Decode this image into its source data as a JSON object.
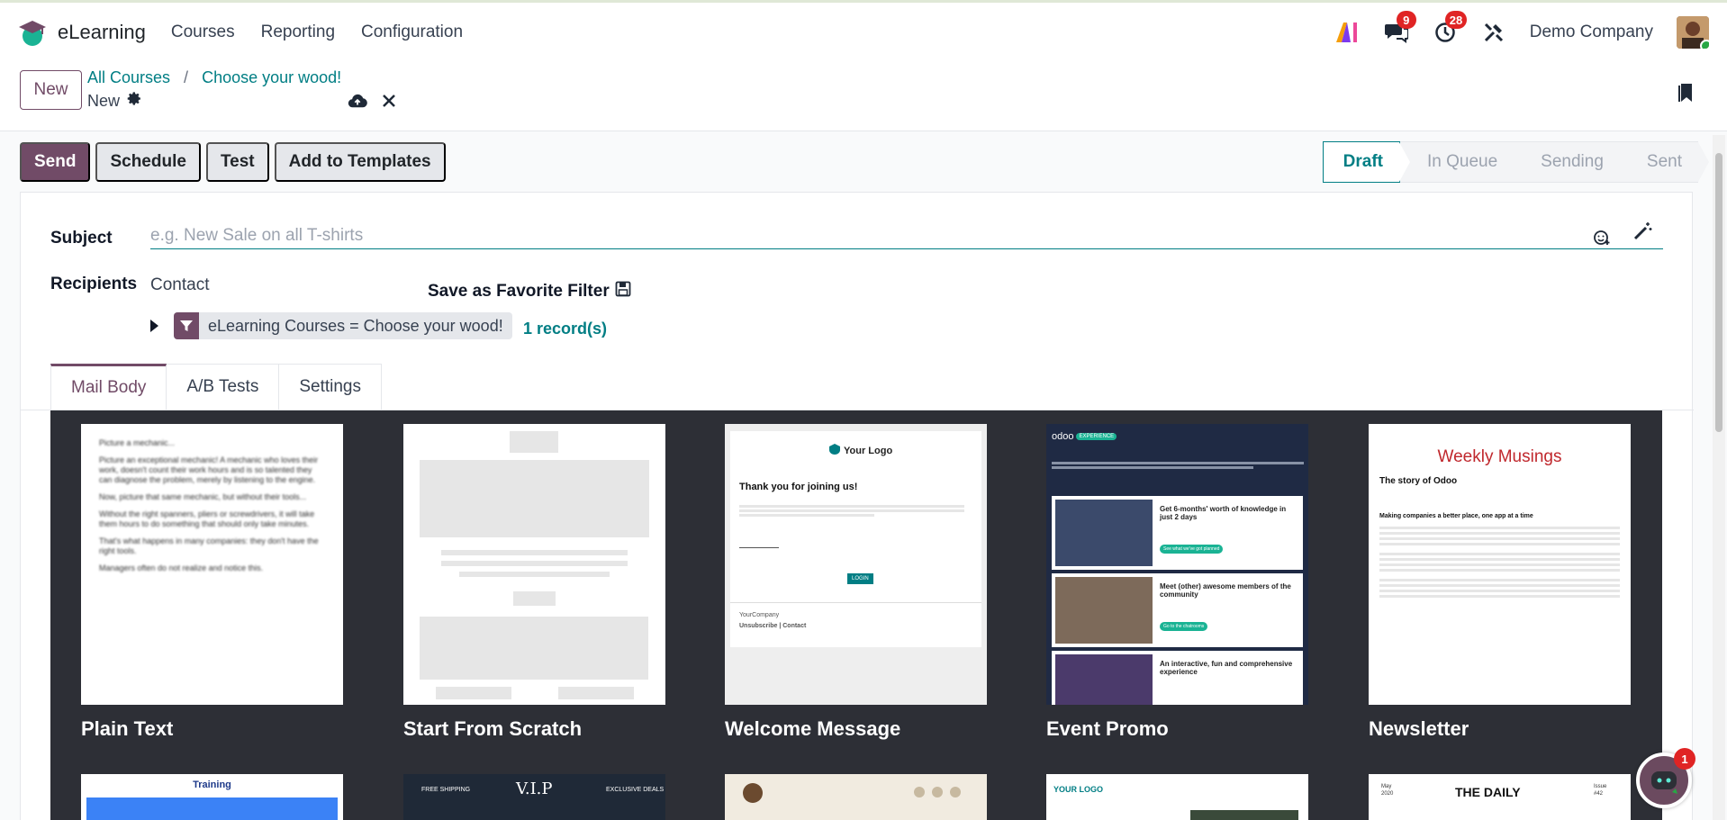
{
  "app": {
    "name": "eLearning",
    "menus": [
      "Courses",
      "Reporting",
      "Configuration"
    ]
  },
  "systray": {
    "messages_count": "9",
    "activities_count": "28",
    "company": "Demo Company"
  },
  "control": {
    "new_label": "New",
    "breadcrumb_parent": "All Courses",
    "breadcrumb_sep": "/",
    "breadcrumb_current": "Choose your wood!",
    "record_name": "New"
  },
  "actions": {
    "send": "Send",
    "schedule": "Schedule",
    "test": "Test",
    "add_templates": "Add to Templates"
  },
  "status": {
    "stages": [
      "Draft",
      "In Queue",
      "Sending",
      "Sent"
    ],
    "current": "Draft"
  },
  "form": {
    "subject_label": "Subject",
    "subject_placeholder": "e.g. New Sale on all T-shirts",
    "recipients_label": "Recipients",
    "recipients_value": "Contact",
    "favorite_filter": "Save as Favorite Filter",
    "domain_filter": "eLearning Courses = Choose your wood!",
    "record_count": "1 record(s)"
  },
  "tabs": [
    "Mail Body",
    "A/B Tests",
    "Settings"
  ],
  "templates": {
    "row1": [
      "Plain Text",
      "Start From Scratch",
      "Welcome Message",
      "Event Promo",
      "Newsletter"
    ],
    "welcome": {
      "logo": "Your Logo",
      "heading": "Thank you for joining us!",
      "button": "LOGIN",
      "company": "YourCompany",
      "links": "Unsubscribe | Contact"
    },
    "event": {
      "brand": "odoo",
      "tag": "EXPERIENCE",
      "b1": "Get 6-months' worth of knowledge in just 2 days",
      "b2": "Meet (other) awesome members of the community",
      "b3": "An interactive, fun and comprehensive experience",
      "cta1": "See what we've got planned",
      "cta2": "Go to the chatrooms"
    },
    "newsletter": {
      "title": "Weekly Musings",
      "subtitle": "The story of Odoo",
      "lead": "Making companies a better place, one app at a time"
    },
    "plain": {
      "lines": [
        "Picture a mechanic...",
        "Picture an exceptional mechanic! A mechanic who loves their work, doesn't count their work hours and is so talented they can diagnose the problem, merely by listening to the engine.",
        "Now, picture that same mechanic, but without their tools...",
        "Without the right spanners, pliers or screwdrivers, it will take them hours to do something that should only take minutes.",
        "That's what happens in many companies: they don't have the right tools.",
        "Managers often do not realize and notice this."
      ]
    },
    "row2": {
      "training": "Training",
      "vip": "V.I.P",
      "free_shipping": "FREE SHIPPING",
      "exclusive": "EXCLUSIVE DEALS",
      "your_logo": "YOUR LOGO",
      "daily": "THE DAILY",
      "month": "May",
      "year": "2020",
      "issue": "Issue",
      "issue_no": "#42"
    }
  },
  "chat": {
    "badge": "1"
  },
  "colors": {
    "brand": "#714b67",
    "accent": "#017e84"
  }
}
